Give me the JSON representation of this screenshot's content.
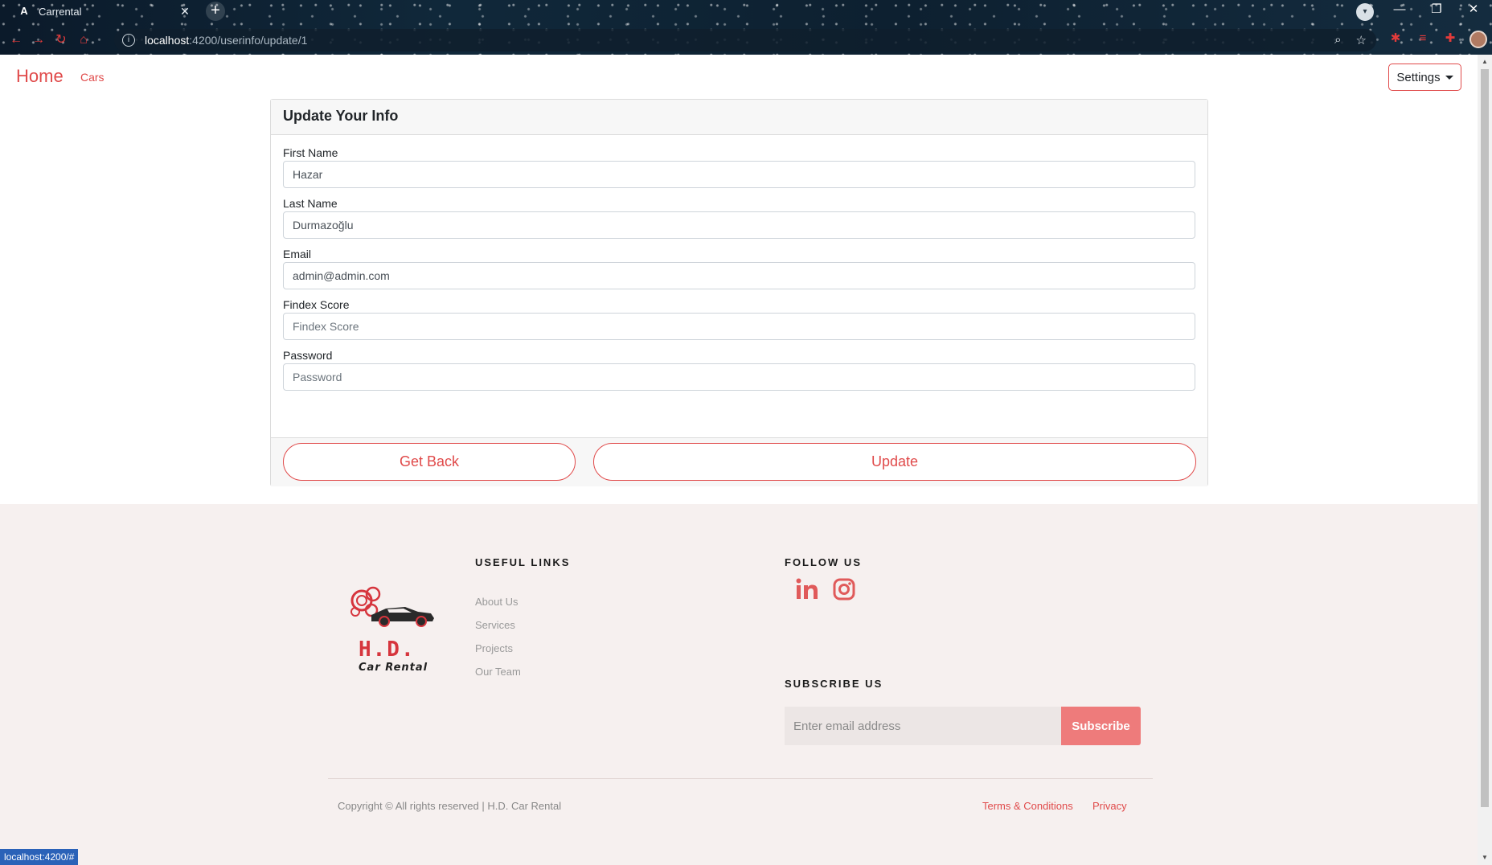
{
  "browser": {
    "tab_title": "Carrental",
    "url_host": "localhost",
    "url_path": ":4200/userinfo/update/1",
    "status_url": "localhost:4200/#"
  },
  "nav": {
    "home": "Home",
    "cars": "Cars",
    "settings": "Settings"
  },
  "form": {
    "title": "Update Your Info",
    "fields": [
      {
        "label": "First Name",
        "value": "Hazar",
        "placeholder": "First Name"
      },
      {
        "label": "Last Name",
        "value": "Durmazoğlu",
        "placeholder": "Last Name"
      },
      {
        "label": "Email",
        "value": "admin@admin.com",
        "placeholder": "Email"
      },
      {
        "label": "Findex Score",
        "value": "",
        "placeholder": "Findex Score"
      },
      {
        "label": "Password",
        "value": "",
        "placeholder": "Password"
      }
    ],
    "back_label": "Get Back",
    "update_label": "Update"
  },
  "footer": {
    "logo_line1": "H.D.",
    "logo_line2": "Car Rental",
    "useful_links_heading": "USEFUL LINKS",
    "useful_links": [
      "About Us",
      "Services",
      "Projects",
      "Our Team"
    ],
    "follow_heading": "FOLLOW US",
    "subscribe_heading": "SUBSCRIBE US",
    "subscribe_placeholder": "Enter email address",
    "subscribe_button": "Subscribe",
    "copyright": "Copyright © All rights reserved | H.D. Car Rental",
    "terms": "Terms & Conditions",
    "privacy": "Privacy"
  },
  "colors": {
    "accent": "#e04a4a",
    "subscribe_button": "#ee7b7b",
    "footer_bg": "#f6f0ef"
  },
  "icons": [
    "info-icon",
    "search-icon",
    "star-icon",
    "extension-icon",
    "linkedin-icon",
    "instagram-icon"
  ]
}
